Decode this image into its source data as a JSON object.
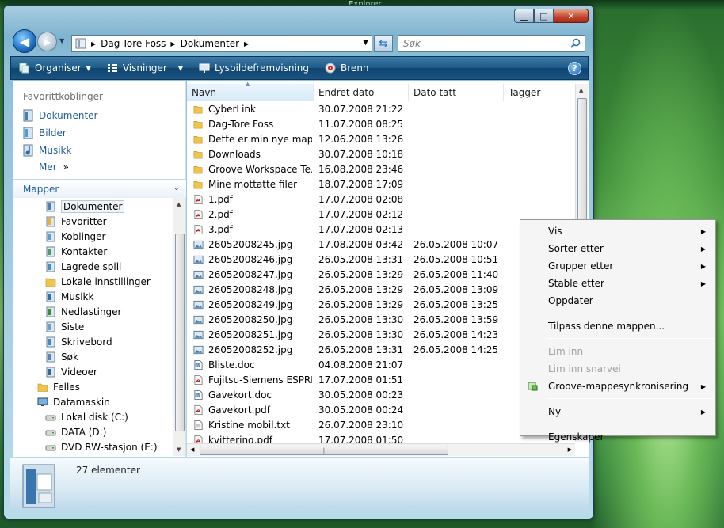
{
  "background_window_title": "Explorer",
  "address": {
    "crumbs": [
      "Dag-Tore Foss",
      "Dokumenter"
    ],
    "search_placeholder": "Søk"
  },
  "toolbar": {
    "organize": "Organiser",
    "views": "Visninger",
    "slideshow": "Lysbildefremvisning",
    "burn": "Brenn"
  },
  "favorites": {
    "title": "Favorittkoblinger",
    "items": [
      "Dokumenter",
      "Bilder",
      "Musikk"
    ],
    "more": "Mer",
    "more_glyph": "»"
  },
  "folders": {
    "title": "Mapper",
    "tree": [
      {
        "label": "Dokumenter",
        "level": 2,
        "icon": "documents-folder-icon",
        "selected": true
      },
      {
        "label": "Favoritter",
        "level": 2,
        "icon": "favorites-folder-icon"
      },
      {
        "label": "Koblinger",
        "level": 2,
        "icon": "links-folder-icon"
      },
      {
        "label": "Kontakter",
        "level": 2,
        "icon": "contacts-folder-icon"
      },
      {
        "label": "Lagrede spill",
        "level": 2,
        "icon": "saved-games-folder-icon"
      },
      {
        "label": "Lokale innstillinger",
        "level": 2,
        "icon": "folder-icon"
      },
      {
        "label": "Musikk",
        "level": 2,
        "icon": "music-folder-icon"
      },
      {
        "label": "Nedlastinger",
        "level": 2,
        "icon": "downloads-folder-icon"
      },
      {
        "label": "Siste",
        "level": 2,
        "icon": "recent-folder-icon"
      },
      {
        "label": "Skrivebord",
        "level": 2,
        "icon": "desktop-folder-icon"
      },
      {
        "label": "Søk",
        "level": 2,
        "icon": "searches-folder-icon"
      },
      {
        "label": "Videoer",
        "level": 2,
        "icon": "videos-folder-icon"
      },
      {
        "label": "Felles",
        "level": 1,
        "icon": "folder-icon"
      },
      {
        "label": "Datamaskin",
        "level": 1,
        "icon": "computer-icon"
      },
      {
        "label": "Lokal disk (C:)",
        "level": 2,
        "icon": "hard-disk-icon"
      },
      {
        "label": "DATA (D:)",
        "level": 2,
        "icon": "hard-disk-icon"
      },
      {
        "label": "DVD RW-stasjon (E:)",
        "level": 2,
        "icon": "dvd-drive-icon"
      }
    ]
  },
  "columns": [
    "Navn",
    "Endret dato",
    "Dato tatt",
    "Tagger"
  ],
  "files": [
    {
      "name": "CyberLink",
      "modified": "30.07.2008 21:22",
      "taken": "",
      "type": "folder"
    },
    {
      "name": "Dag-Tore Foss",
      "modified": "11.07.2008 08:25",
      "taken": "",
      "type": "folder"
    },
    {
      "name": "Dette er min nye mappe",
      "modified": "12.06.2008 13:26",
      "taken": "",
      "type": "folder"
    },
    {
      "name": "Downloads",
      "modified": "30.07.2008 10:18",
      "taken": "",
      "type": "folder"
    },
    {
      "name": "Groove Workspace Te...",
      "modified": "16.08.2008 23:46",
      "taken": "",
      "type": "folder"
    },
    {
      "name": "Mine mottatte filer",
      "modified": "18.07.2008 17:09",
      "taken": "",
      "type": "folder"
    },
    {
      "name": "1.pdf",
      "modified": "17.07.2008 02:08",
      "taken": "",
      "type": "pdf"
    },
    {
      "name": "2.pdf",
      "modified": "17.07.2008 02:12",
      "taken": "",
      "type": "pdf"
    },
    {
      "name": "3.pdf",
      "modified": "17.07.2008 02:13",
      "taken": "",
      "type": "pdf"
    },
    {
      "name": "26052008245.jpg",
      "modified": "17.08.2008 03:42",
      "taken": "26.05.2008 10:07",
      "type": "jpg"
    },
    {
      "name": "26052008246.jpg",
      "modified": "26.05.2008 13:31",
      "taken": "26.05.2008 10:51",
      "type": "jpg"
    },
    {
      "name": "26052008247.jpg",
      "modified": "26.05.2008 13:29",
      "taken": "26.05.2008 11:40",
      "type": "jpg"
    },
    {
      "name": "26052008248.jpg",
      "modified": "26.05.2008 13:29",
      "taken": "26.05.2008 13:09",
      "type": "jpg"
    },
    {
      "name": "26052008249.jpg",
      "modified": "26.05.2008 13:29",
      "taken": "26.05.2008 13:25",
      "type": "jpg"
    },
    {
      "name": "26052008250.jpg",
      "modified": "26.05.2008 13:30",
      "taken": "26.05.2008 13:59",
      "type": "jpg"
    },
    {
      "name": "26052008251.jpg",
      "modified": "26.05.2008 13:30",
      "taken": "26.05.2008 14:23",
      "type": "jpg"
    },
    {
      "name": "26052008252.jpg",
      "modified": "26.05.2008 13:31",
      "taken": "26.05.2008 14:25",
      "type": "jpg"
    },
    {
      "name": "Bliste.doc",
      "modified": "04.08.2008 21:07",
      "taken": "",
      "type": "doc"
    },
    {
      "name": "Fujitsu-Siemens ESPRI...",
      "modified": "17.07.2008 01:51",
      "taken": "",
      "type": "pdf"
    },
    {
      "name": "Gavekort.doc",
      "modified": "30.05.2008 00:23",
      "taken": "",
      "type": "doc"
    },
    {
      "name": "Gavekort.pdf",
      "modified": "30.05.2008 00:24",
      "taken": "",
      "type": "pdf"
    },
    {
      "name": "Kristine mobil.txt",
      "modified": "26.07.2008 23:10",
      "taken": "",
      "type": "txt"
    },
    {
      "name": "kvittering.pdf",
      "modified": "17.07.2008 01:50",
      "taken": "",
      "type": "pdf"
    }
  ],
  "details": {
    "count": "27 elementer"
  },
  "context_menu": [
    {
      "label": "Vis",
      "submenu": true
    },
    {
      "label": "Sorter etter",
      "submenu": true
    },
    {
      "label": "Grupper etter",
      "submenu": true
    },
    {
      "label": "Stable etter",
      "submenu": true
    },
    {
      "label": "Oppdater"
    },
    {
      "separator": true
    },
    {
      "label": "Tilpass denne mappen..."
    },
    {
      "separator": true
    },
    {
      "label": "Lim inn",
      "disabled": true
    },
    {
      "label": "Lim inn snarvei",
      "disabled": true
    },
    {
      "label": "Groove-mappesynkronisering",
      "submenu": true,
      "icon": "groove-sync-icon"
    },
    {
      "separator": true
    },
    {
      "label": "Ny",
      "submenu": true
    },
    {
      "separator": true
    },
    {
      "label": "Egenskaper"
    }
  ],
  "colors": {
    "accent": "#1e5c9a",
    "toolbar": "#1d5a88",
    "folder": "#f2c54a",
    "pdf": "#c8221c"
  }
}
